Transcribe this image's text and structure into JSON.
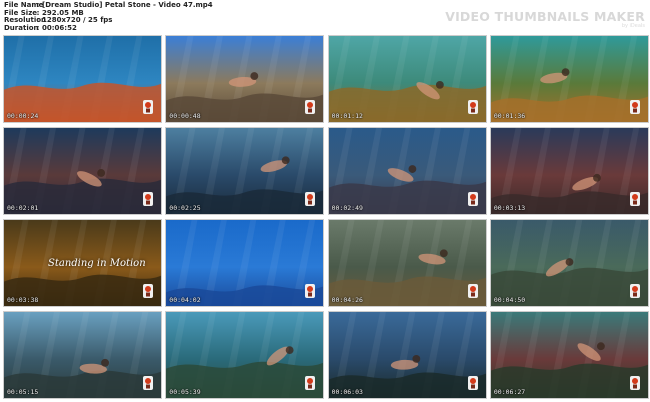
{
  "file_info": {
    "rows": [
      {
        "key": "File Name",
        "value": "[Dream Studio] Petal Stone - Video 47.mp4"
      },
      {
        "key": "File Size",
        "value": "292.05 MB"
      },
      {
        "key": "Resolution",
        "value": "1280x720 / 25 fps"
      },
      {
        "key": "Duration",
        "value": "00:06:52"
      }
    ],
    "separator": ":"
  },
  "watermark": {
    "title": "VIDEO THUMBNAILS MAKER",
    "subtitle": "by iDeaIs"
  },
  "thumbnails": [
    {
      "time": "00:00:24",
      "scene": "coral-surface",
      "top": "#1f6fa8",
      "mid": "#2e86c1",
      "bottom": "#c4552a"
    },
    {
      "time": "00:00:48",
      "scene": "rocky-shore",
      "top": "#3b7fd6",
      "mid": "#8c7a5c",
      "bottom": "#5a4a38"
    },
    {
      "time": "00:01:12",
      "scene": "diver-bright",
      "top": "#4fa6a6",
      "mid": "#3d8a7a",
      "bottom": "#8a6a2a"
    },
    {
      "time": "00:01:36",
      "scene": "diver-reef",
      "top": "#2f9a9a",
      "mid": "#5a7a3a",
      "bottom": "#a5702a"
    },
    {
      "time": "00:02:01",
      "scene": "two-divers",
      "top": "#1e3a5c",
      "mid": "#5a3a3a",
      "bottom": "#2a2a3a"
    },
    {
      "time": "00:02:25",
      "scene": "divers-rays",
      "top": "#4d7fa0",
      "mid": "#2a4a6a",
      "bottom": "#1a2a3a"
    },
    {
      "time": "00:02:49",
      "scene": "diver-floor",
      "top": "#2a5a8a",
      "mid": "#3a5a7a",
      "bottom": "#3a3a4a"
    },
    {
      "time": "00:03:13",
      "scene": "diver-coral",
      "top": "#2a3a5a",
      "mid": "#6a3a3a",
      "bottom": "#3a2a2a"
    },
    {
      "time": "00:03:38",
      "scene": "title-card",
      "top": "#4a3a1a",
      "mid": "#8a5a1a",
      "bottom": "#3a2a10"
    },
    {
      "time": "00:04:02",
      "scene": "open-blue",
      "top": "#1a6aca",
      "mid": "#2a7ad6",
      "bottom": "#1a4a9a"
    },
    {
      "time": "00:04:26",
      "scene": "swimmers-surface",
      "top": "#6a7a6a",
      "mid": "#4a5a4a",
      "bottom": "#6a5a3a"
    },
    {
      "time": "00:04:50",
      "scene": "diver-seabed",
      "top": "#3a5a6a",
      "mid": "#4a6a5a",
      "bottom": "#3a4a3a"
    },
    {
      "time": "00:05:15",
      "scene": "diver-waves",
      "top": "#6aa0c0",
      "mid": "#3a5a6a",
      "bottom": "#2a3a3a"
    },
    {
      "time": "00:05:39",
      "scene": "diver-fish",
      "top": "#4a9aba",
      "mid": "#2a6a7a",
      "bottom": "#2a4a3a"
    },
    {
      "time": "00:06:03",
      "scene": "diver-shadow",
      "top": "#3a6a9a",
      "mid": "#2a4a6a",
      "bottom": "#1a2a2a"
    },
    {
      "time": "00:06:27",
      "scene": "diver-red",
      "top": "#3a7a7a",
      "mid": "#6a3a3a",
      "bottom": "#2a3a2a"
    }
  ],
  "title_card_text": "Standing in Motion"
}
